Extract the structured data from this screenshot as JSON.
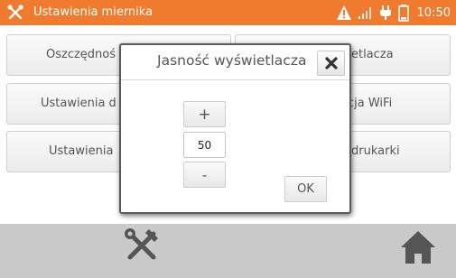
{
  "header": {
    "title": "Ustawienia miernika",
    "time": "10:50",
    "accent": "#f07a2e"
  },
  "menu": {
    "tile_1_left": "Oszczędnoś",
    "tile_1_right": "etlacza",
    "tile_2_left": "Ustawienia d",
    "tile_2_right": "cja WiFi",
    "tile_3_left": "Ustawienia",
    "tile_3_right": "drukarki"
  },
  "dialog": {
    "title": "Jasność wyświetlacza",
    "plus_label": "+",
    "value": "50",
    "minus_label": "-",
    "ok_label": "OK"
  },
  "icons": {
    "app": "tools-icon",
    "warning": "warning-icon",
    "signal": "signal-icon",
    "power": "plug-icon",
    "battery": "battery-icon",
    "tools": "tools-icon",
    "home": "home-icon"
  }
}
